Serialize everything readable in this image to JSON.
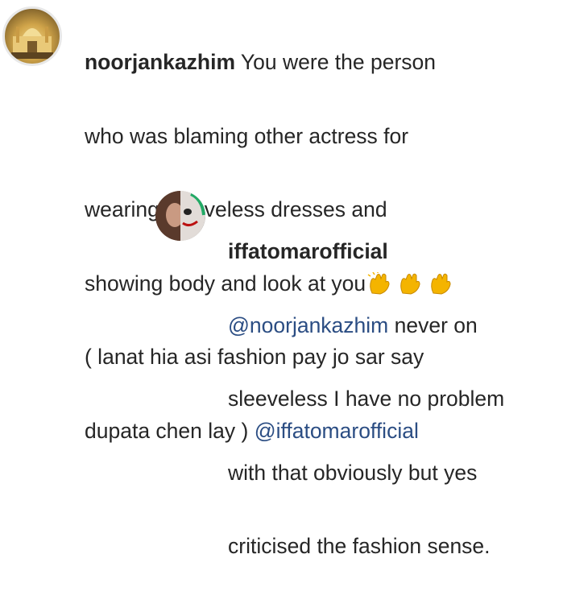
{
  "main_comment": {
    "username": "noorjankazhim",
    "lines": [
      "You were the person",
      "who was blaming other actress for",
      "wearing sleeveless dresses and",
      "showing body and look at you",
      "( lanat hia asi fashion pay jo sar say",
      "dupata chen lay )"
    ],
    "mention": "@iffatomarofficial",
    "emoji_names": [
      "clapping-hands-icon",
      "clapping-hands-icon",
      "clapping-hands-icon"
    ]
  },
  "reply_comment": {
    "username": "iffatomarofficial",
    "mention": "@noorjankazhim",
    "lines": [
      "never on",
      "sleeveless I have no problem",
      "with that obviously but yes",
      "criticised the fashion sense."
    ]
  },
  "colors": {
    "text": "#262626",
    "mention": "#2b4d83",
    "emoji": "#f4b400"
  }
}
